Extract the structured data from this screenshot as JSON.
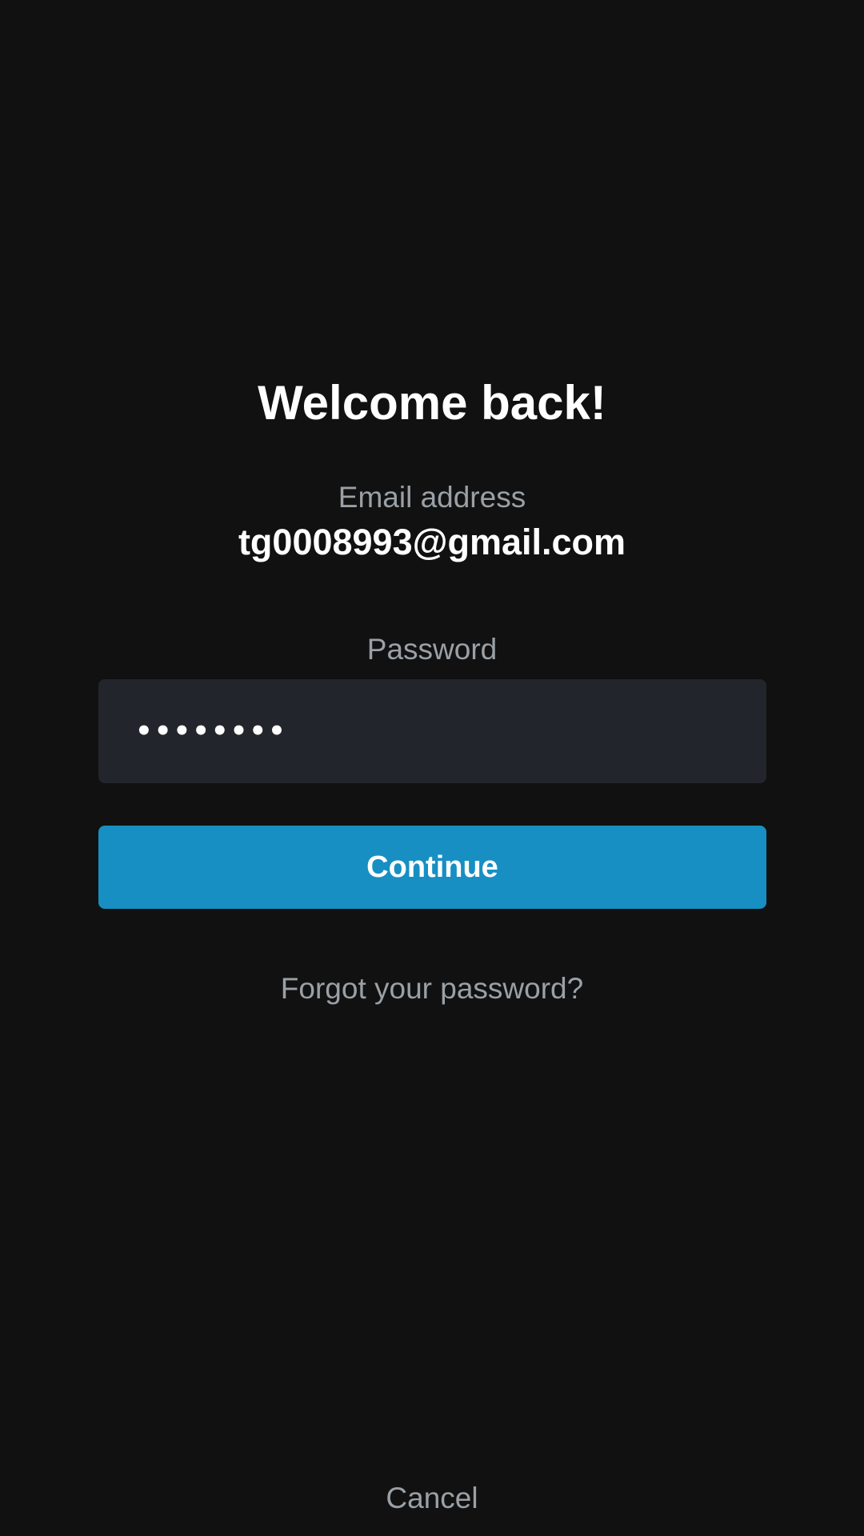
{
  "login": {
    "title": "Welcome back!",
    "email_label": "Email address",
    "email_value": "tg0008993@gmail.com",
    "password_label": "Password",
    "password_value": "••••••••",
    "continue_label": "Continue",
    "forgot_label": "Forgot your password?",
    "cancel_label": "Cancel"
  },
  "colors": {
    "background": "#111111",
    "field_background": "#22252b",
    "accent": "#188fc2",
    "muted_text": "#9aa0a6",
    "primary_text": "#ffffff"
  }
}
